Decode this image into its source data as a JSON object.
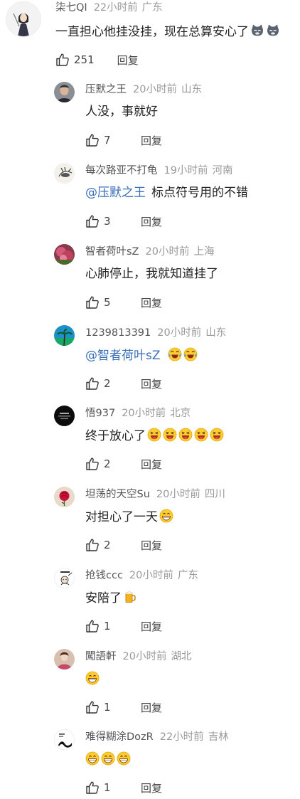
{
  "main_comment": {
    "author": "柒七QI",
    "time": "22小时前",
    "location": "广东",
    "text": "一直担心他挂没挂，现在总算安心了",
    "likes": "251",
    "reply_label": "回复"
  },
  "replies": [
    {
      "author": "压默之王",
      "time": "20小时前",
      "location": "山东",
      "mention": "",
      "text": "人没，事就好",
      "likes": "7",
      "reply_label": "回复"
    },
    {
      "author": "每次路亚不打龟",
      "time": "19小时前",
      "location": "河南",
      "mention": "@压默之王",
      "text": "标点符号用的不错",
      "likes": "3",
      "reply_label": "回复"
    },
    {
      "author": "智者荷叶sZ",
      "time": "20小时前",
      "location": "上海",
      "mention": "",
      "text": "心肺停止，我就知道挂了",
      "likes": "5",
      "reply_label": "回复"
    },
    {
      "author": "1239813391",
      "time": "20小时前",
      "location": "山东",
      "mention": "@智者荷叶sZ",
      "text": "",
      "likes": "2",
      "reply_label": "回复"
    },
    {
      "author": "悟937",
      "time": "20小时前",
      "location": "北京",
      "mention": "",
      "text": "终于放心了",
      "likes": "2",
      "reply_label": "回复"
    },
    {
      "author": "坦荡的天空Su",
      "time": "20小时前",
      "location": "四川",
      "mention": "",
      "text": "对担心了一天",
      "likes": "2",
      "reply_label": "回复"
    },
    {
      "author": "抢钱ccc",
      "time": "20小时前",
      "location": "广东",
      "mention": "",
      "text": "安陪了",
      "likes": "1",
      "reply_label": "回复"
    },
    {
      "author": "闖語軒",
      "time": "20小时前",
      "location": "湖北",
      "mention": "",
      "text": "",
      "likes": "1",
      "reply_label": "回复"
    },
    {
      "author": "难得糊涂DozR",
      "time": "22小时前",
      "location": "吉林",
      "mention": "",
      "text": "",
      "likes": "1",
      "reply_label": "回复"
    }
  ]
}
